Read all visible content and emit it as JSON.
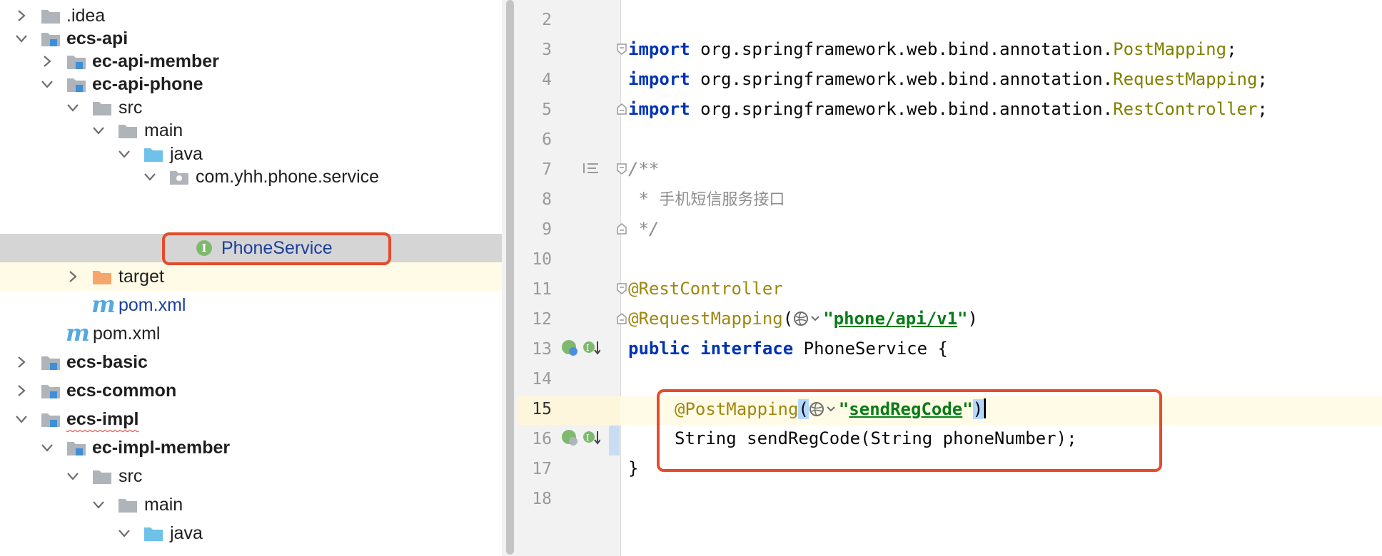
{
  "tree": {
    "items": [
      {
        "label": ".idea",
        "arrow": "right",
        "icon": "folder"
      },
      {
        "label": "ecs-api",
        "arrow": "down",
        "icon": "module"
      },
      {
        "label": "ec-api-member",
        "arrow": "right",
        "icon": "module"
      },
      {
        "label": "ec-api-phone",
        "arrow": "down",
        "icon": "module"
      },
      {
        "label": "src",
        "arrow": "down",
        "icon": "folder"
      },
      {
        "label": "main",
        "arrow": "down",
        "icon": "folder"
      },
      {
        "label": "java",
        "arrow": "down",
        "icon": "source-folder"
      },
      {
        "label": "com.yhh.phone.service",
        "arrow": "down",
        "icon": "package"
      },
      {
        "label": "PhoneService",
        "arrow": "",
        "icon": "interface"
      },
      {
        "label": "target",
        "arrow": "right",
        "icon": "excluded-folder"
      },
      {
        "label": "pom.xml",
        "arrow": "",
        "icon": "maven"
      },
      {
        "label": "pom.xml",
        "arrow": "",
        "icon": "maven"
      },
      {
        "label": "ecs-basic",
        "arrow": "right",
        "icon": "module"
      },
      {
        "label": "ecs-common",
        "arrow": "right",
        "icon": "module"
      },
      {
        "label": "ecs-impl",
        "arrow": "down",
        "icon": "module"
      },
      {
        "label": "ec-impl-member",
        "arrow": "down",
        "icon": "module"
      },
      {
        "label": "src",
        "arrow": "down",
        "icon": "folder"
      },
      {
        "label": "main",
        "arrow": "down",
        "icon": "folder"
      },
      {
        "label": "java",
        "arrow": "down",
        "icon": "source-folder"
      }
    ],
    "interface_badge": "I"
  },
  "editor": {
    "line_numbers": [
      "2",
      "3",
      "4",
      "5",
      "6",
      "7",
      "8",
      "9",
      "10",
      "11",
      "12",
      "13",
      "14",
      "15",
      "16",
      "17",
      "18"
    ],
    "current_line": "15",
    "lines": {
      "l3_kw": "import",
      "l3_pkg": " org.springframework.web.bind.annotation.",
      "l3_cls": "PostMapping",
      "l3_end": ";",
      "l4_kw": "import",
      "l4_pkg": " org.springframework.web.bind.annotation.",
      "l4_cls": "RequestMapping",
      "l4_end": ";",
      "l5_kw": "import",
      "l5_pkg": " org.springframework.web.bind.annotation.",
      "l5_cls": "RestController",
      "l5_end": ";",
      "l7": "/**",
      "l8_star": " * ",
      "l8_text": "手机短信服务接口",
      "l9": " */",
      "l11": "@RestController",
      "l12_ann": "@RequestMapping",
      "l12_open": "(",
      "l12_q1": "\"",
      "l12_str": "phone/api/v1",
      "l12_q2": "\"",
      "l12_close": ")",
      "l13_kw1": "public",
      "l13_kw2": "interface",
      "l13_name": " PhoneService {",
      "l15_ann": "@PostMapping",
      "l15_open": "(",
      "l15_q1": "\"",
      "l15_str": "sendRegCode",
      "l15_q2": "\"",
      "l15_close": ")",
      "l16": "String sendRegCode(String phoneNumber);",
      "l17": "}"
    }
  },
  "colors": {
    "keyword": "#0033b3",
    "annotation": "#9e880d",
    "class_ref": "#808000",
    "string": "#067d17",
    "comment": "#8c8c8c",
    "highlight_box": "#e54b2c",
    "selection_row": "#d5d5d5"
  }
}
